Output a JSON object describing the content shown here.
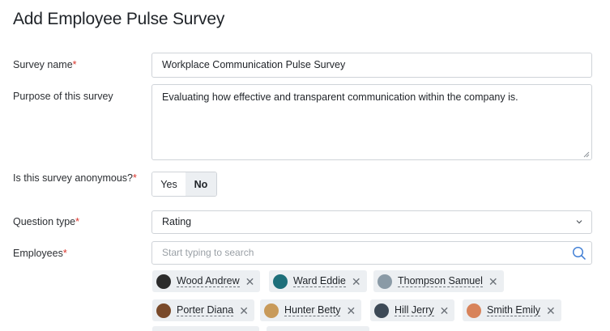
{
  "page": {
    "title": "Add Employee Pulse Survey"
  },
  "form": {
    "survey_name": {
      "label": "Survey name",
      "required_mark": "*",
      "value": "Workplace Communication Pulse Survey"
    },
    "purpose": {
      "label": "Purpose of this survey",
      "value": "Evaluating how effective and transparent communication within the company is."
    },
    "anonymous": {
      "label": "Is this survey anonymous?",
      "required_mark": "*",
      "options": [
        "Yes",
        "No"
      ],
      "selected": "No"
    },
    "question_type": {
      "label": "Question type",
      "required_mark": "*",
      "value": "Rating"
    },
    "employees": {
      "label": "Employees",
      "required_mark": "*",
      "placeholder": "Start typing to search",
      "selected": [
        {
          "name": "Wood Andrew",
          "avatar_color": "#2b2b2b"
        },
        {
          "name": "Ward Eddie",
          "avatar_color": "#1e6f7a"
        },
        {
          "name": "Thompson Samuel",
          "avatar_color": "#8a9aa6"
        },
        {
          "name": "Porter Diana",
          "avatar_color": "#7a4a2a"
        },
        {
          "name": "Hunter Betty",
          "avatar_color": "#c89a5a"
        },
        {
          "name": "Hill Jerry",
          "avatar_color": "#3d4a57"
        },
        {
          "name": "Smith Emily",
          "avatar_color": "#d8835a"
        }
      ]
    }
  },
  "colors": {
    "required": "#d9342b",
    "tag_bg": "#eceff2",
    "border": "#cfd3d8",
    "search_icon": "#3b7bd4"
  },
  "icons": {
    "search": "search-icon",
    "chevron": "chevron-down-icon",
    "remove": "close-icon"
  }
}
